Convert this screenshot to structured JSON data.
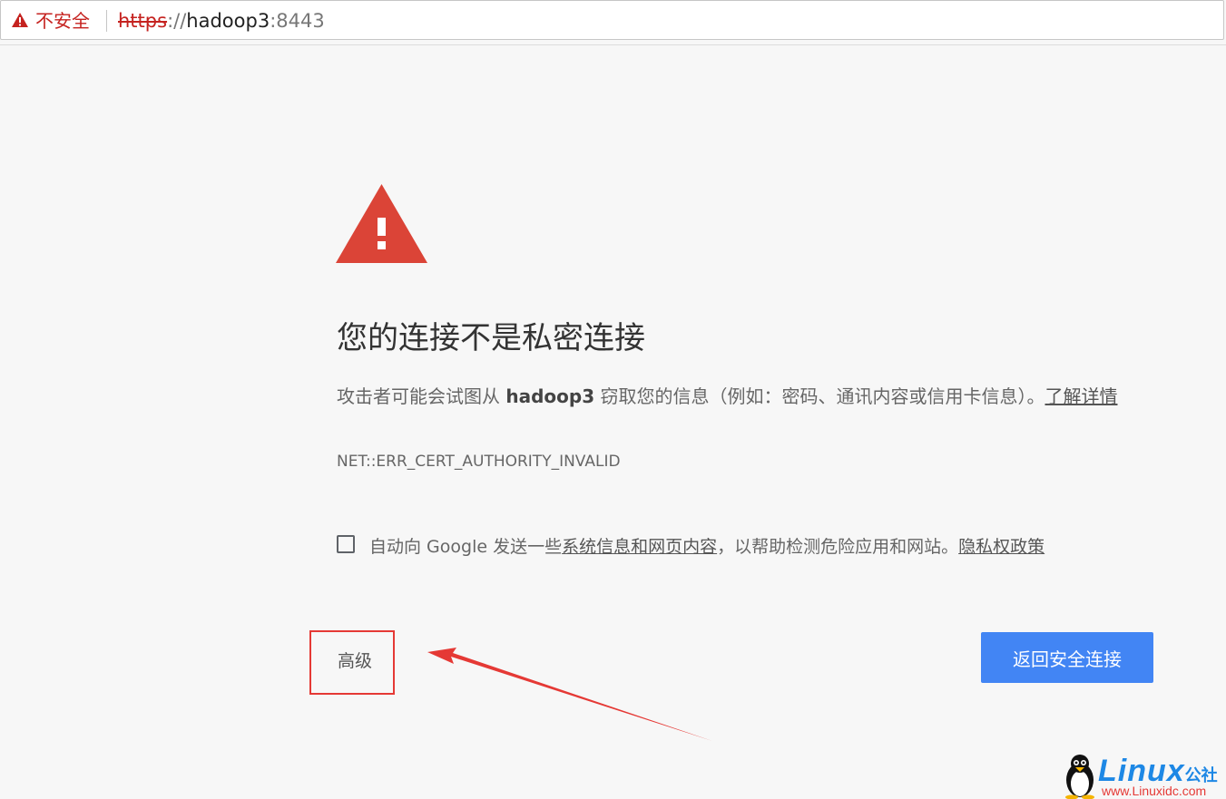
{
  "address_bar": {
    "security_label": "不安全",
    "url_scheme": "https",
    "url_slashes": "://",
    "url_host": "hadoop3",
    "url_port": ":8443"
  },
  "interstitial": {
    "heading": "您的连接不是私密连接",
    "message_prefix": "攻击者可能会试图从 ",
    "message_host": "hadoop3",
    "message_suffix": " 窃取您的信息（例如：密码、通讯内容或信用卡信息）。",
    "learn_more_link": "了解详情",
    "error_code": "NET::ERR_CERT_AUTHORITY_INVALID",
    "checkbox": {
      "checked": false,
      "text_prefix": "自动向 Google 发送一些",
      "text_link": "系统信息和网页内容",
      "text_suffix": "，以帮助检测危险应用和网站。",
      "privacy_link": "隐私权政策"
    },
    "advanced_button": "高级",
    "back_button": "返回安全连接"
  },
  "watermark": {
    "brand": "Linux",
    "brand_cn": "公社",
    "url": "www.Linuxidc.com"
  },
  "colors": {
    "page_bg": "#f7f7f7",
    "warning_red": "#db4437",
    "primary_blue": "#4285f4",
    "annotation_red": "#e53935"
  },
  "icons": {
    "security": "warning-triangle-icon",
    "hero": "warning-triangle-icon",
    "annotation": "red-arrow"
  }
}
